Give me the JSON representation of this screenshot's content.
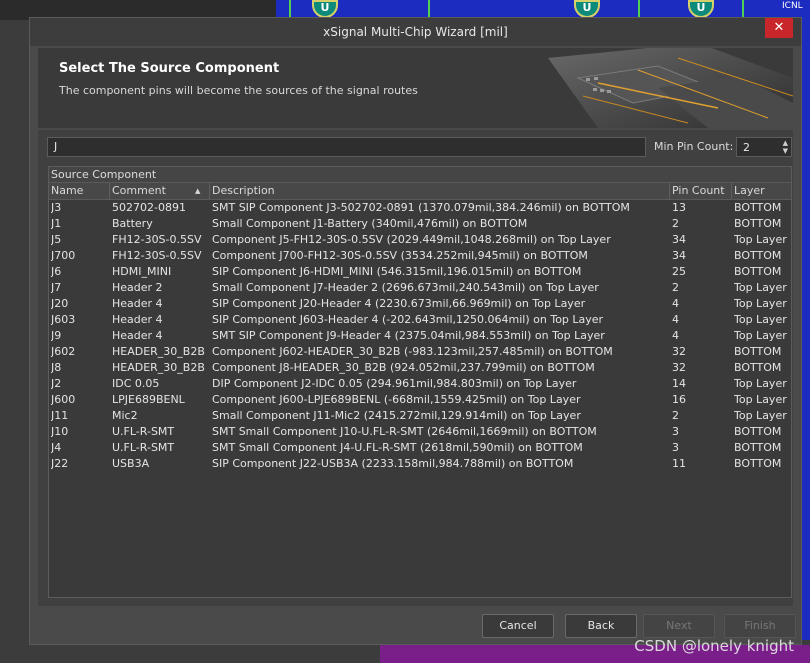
{
  "window": {
    "title": "xSignal Multi-Chip Wizard [mil]",
    "close_glyph": "✕"
  },
  "header": {
    "title": "Select The Source Component",
    "subtitle": "The component pins will become the sources of the signal routes"
  },
  "search": {
    "value": "J"
  },
  "min_pin": {
    "label": "Min Pin Count:",
    "value": "2"
  },
  "grid": {
    "title": "Source Component",
    "columns": [
      "Name",
      "Comment",
      "Description",
      "Pin Count",
      "Layer"
    ],
    "sort_glyph": "▲",
    "rows": [
      [
        "J3",
        "502702-0891",
        "SMT SIP Component J3-502702-0891 (1370.079mil,384.246mil) on BOTTOM",
        "13",
        "BOTTOM"
      ],
      [
        "J1",
        "Battery",
        "Small Component J1-Battery (340mil,476mil) on BOTTOM",
        "2",
        "BOTTOM"
      ],
      [
        "J5",
        "FH12-30S-0.5SV",
        "Component J5-FH12-30S-0.5SV (2029.449mil,1048.268mil) on Top Layer",
        "34",
        "Top Layer"
      ],
      [
        "J700",
        "FH12-30S-0.5SV",
        "Component J700-FH12-30S-0.5SV (3534.252mil,945mil) on BOTTOM",
        "34",
        "BOTTOM"
      ],
      [
        "J6",
        "HDMI_MINI",
        "SIP Component J6-HDMI_MINI (546.315mil,196.015mil) on BOTTOM",
        "25",
        "BOTTOM"
      ],
      [
        "J7",
        "Header 2",
        "Small Component J7-Header 2 (2696.673mil,240.543mil) on Top Layer",
        "2",
        "Top Layer"
      ],
      [
        "J20",
        "Header 4",
        "SIP Component J20-Header 4 (2230.673mil,66.969mil) on Top Layer",
        "4",
        "Top Layer"
      ],
      [
        "J603",
        "Header 4",
        "SIP Component J603-Header 4 (-202.643mil,1250.064mil) on Top Layer",
        "4",
        "Top Layer"
      ],
      [
        "J9",
        "Header 4",
        "SMT SIP Component J9-Header 4 (2375.04mil,984.553mil) on Top Layer",
        "4",
        "Top Layer"
      ],
      [
        "J602",
        "HEADER_30_B2B",
        "Component J602-HEADER_30_B2B (-983.123mil,257.485mil) on BOTTOM",
        "32",
        "BOTTOM"
      ],
      [
        "J8",
        "HEADER_30_B2B",
        "Component J8-HEADER_30_B2B (924.052mil,237.799mil) on BOTTOM",
        "32",
        "BOTTOM"
      ],
      [
        "J2",
        "IDC 0.05",
        "DIP Component J2-IDC 0.05 (294.961mil,984.803mil) on Top Layer",
        "14",
        "Top Layer"
      ],
      [
        "J600",
        "LPJE689BENL",
        "Component J600-LPJE689BENL (-668mil,1559.425mil) on Top Layer",
        "16",
        "Top Layer"
      ],
      [
        "J11",
        "Mic2",
        "Small Component J11-Mic2 (2415.272mil,129.914mil) on Top Layer",
        "2",
        "Top Layer"
      ],
      [
        "J10",
        "U.FL-R-SMT",
        "SMT Small Component J10-U.FL-R-SMT (2646mil,1669mil) on BOTTOM",
        "3",
        "BOTTOM"
      ],
      [
        "J4",
        "U.FL-R-SMT",
        "SMT Small Component J4-U.FL-R-SMT (2618mil,590mil) on BOTTOM",
        "3",
        "BOTTOM"
      ],
      [
        "J22",
        "USB3A",
        "SIP Component J22-USB3A (2233.158mil,984.788mil) on BOTTOM",
        "11",
        "BOTTOM"
      ]
    ]
  },
  "buttons": {
    "cancel": "Cancel",
    "back": "Back",
    "next": "Next",
    "finish": "Finish"
  },
  "watermark": "CSDN @lonely knight",
  "background": {
    "pad_glyph": "U",
    "corner_text": "ICNL"
  },
  "colors": {
    "accent_close": "#c8262a",
    "pcb_blue": "#1c2cc0"
  }
}
